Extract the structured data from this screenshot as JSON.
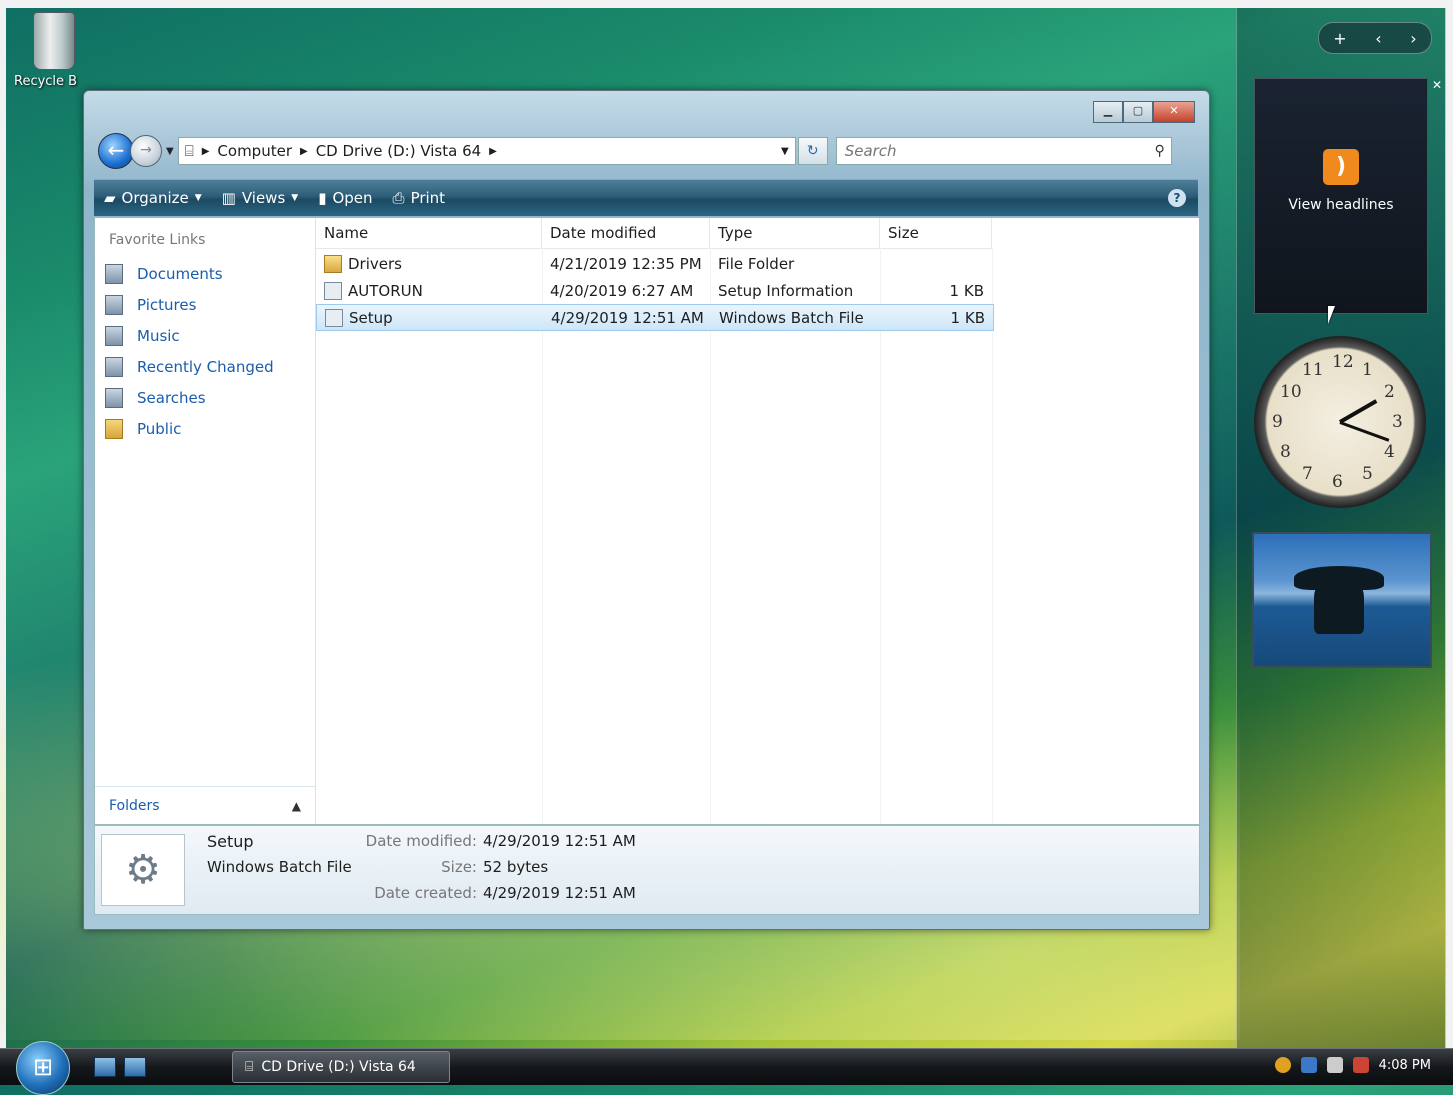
{
  "desktop": {
    "recycle_bin_label": "Recycle B"
  },
  "gadgets": {
    "rss_label": "View headlines",
    "clock_numbers": [
      "12",
      "1",
      "2",
      "3",
      "4",
      "5",
      "6",
      "7",
      "8",
      "9",
      "10",
      "11"
    ]
  },
  "window": {
    "address": {
      "crumbs": [
        "Computer",
        "CD Drive (D:) Vista 64"
      ]
    },
    "search": {
      "placeholder": "Search"
    },
    "toolbar": {
      "organize": "Organize",
      "views": "Views",
      "open": "Open",
      "print": "Print"
    },
    "favorite_links": {
      "heading": "Favorite Links",
      "items": [
        "Documents",
        "Pictures",
        "Music",
        "Recently Changed",
        "Searches",
        "Public"
      ]
    },
    "folders_label": "Folders",
    "columns": [
      "Name",
      "Date modified",
      "Type",
      "Size"
    ],
    "files": [
      {
        "name": "Drivers",
        "date": "4/21/2019 12:35 PM",
        "type": "File Folder",
        "size": ""
      },
      {
        "name": "AUTORUN",
        "date": "4/20/2019 6:27 AM",
        "type": "Setup Information",
        "size": "1 KB"
      },
      {
        "name": "Setup",
        "date": "4/29/2019 12:51 AM",
        "type": "Windows Batch File",
        "size": "1 KB"
      }
    ],
    "details": {
      "name": "Setup",
      "type": "Windows Batch File",
      "props": [
        {
          "label": "Date modified:",
          "value": "4/29/2019 12:51 AM"
        },
        {
          "label": "Size:",
          "value": "52 bytes"
        },
        {
          "label": "Date created:",
          "value": "4/29/2019 12:51 AM"
        }
      ]
    }
  },
  "taskbar": {
    "task_label": "CD Drive (D:) Vista 64",
    "time": "4:08 PM"
  }
}
